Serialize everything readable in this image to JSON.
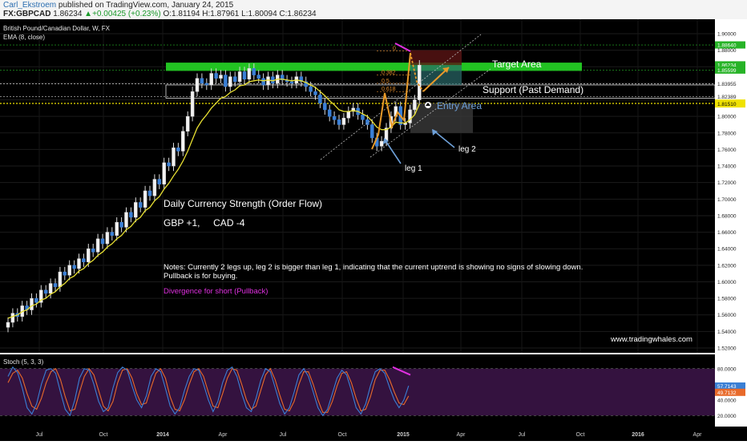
{
  "header": {
    "author": "Carl_Ekstroem",
    "published": "published on TradingView.com, January 24, 2015",
    "symbol": "FX:GBPCAD",
    "last": "1.86234",
    "change": "+0.00425 (+0.23%)",
    "ohlc": "O:1.81194 H:1.87961 L:1.80094 C:1.86234"
  },
  "chart_data": {
    "type": "line",
    "title": "British Pound/Canadian Dollar, W, FX",
    "indicator": "EMA (8, close)",
    "ylim": [
      1.51,
      1.91
    ],
    "y_ticks": [
      "1.90000",
      "1.88000",
      "1.86000",
      "1.84000",
      "1.82000",
      "1.80000",
      "1.78000",
      "1.76000",
      "1.74000",
      "1.72000",
      "1.70000",
      "1.68000",
      "1.66000",
      "1.64000",
      "1.62000",
      "1.60000",
      "1.58000",
      "1.56000",
      "1.54000",
      "1.52000"
    ],
    "x_ticks": [
      "Jul",
      "Oct",
      "2014",
      "Apr",
      "Jul",
      "Oct",
      "2015",
      "Apr",
      "Jul",
      "Oct",
      "2016",
      "Apr"
    ],
    "price_labels": [
      {
        "text": "1.88640",
        "color": "#27b327",
        "value": 1.8864
      },
      {
        "text": "1.86234",
        "color": "#27b327",
        "value": 1.8623
      },
      {
        "text": "1.85599",
        "color": "#27b327",
        "value": 1.856
      },
      {
        "text": "1.83955",
        "color": "#ffffff",
        "value": 1.8396
      },
      {
        "text": "1.82389",
        "color": "#ffffff",
        "value": 1.8239
      },
      {
        "text": "1.81614",
        "color": "#f0e200",
        "value": 1.8161
      },
      {
        "text": "1.81510",
        "color": "#f0e200",
        "value": 1.8151
      }
    ],
    "weekly_close": [
      1.551,
      1.562,
      1.558,
      1.571,
      1.566,
      1.58,
      1.575,
      1.59,
      1.586,
      1.598,
      1.594,
      1.612,
      1.608,
      1.62,
      1.616,
      1.628,
      1.624,
      1.64,
      1.636,
      1.652,
      1.646,
      1.66,
      1.656,
      1.672,
      1.666,
      1.684,
      1.678,
      1.696,
      1.69,
      1.71,
      1.704,
      1.724,
      1.718,
      1.744,
      1.74,
      1.762,
      1.758,
      1.782,
      1.8,
      1.83,
      1.846,
      1.84,
      1.838,
      1.852,
      1.846,
      1.85,
      1.836,
      1.848,
      1.842,
      1.854,
      1.845,
      1.858,
      1.85,
      1.846,
      1.838,
      1.848,
      1.84,
      1.85,
      1.844,
      1.842,
      1.84,
      1.848,
      1.842,
      1.836,
      1.83,
      1.826,
      1.816,
      1.808,
      1.8,
      1.796,
      1.79,
      1.798,
      1.806,
      1.81,
      1.802,
      1.796,
      1.79,
      1.774,
      1.764,
      1.77,
      1.786,
      1.8,
      1.812,
      1.79,
      1.792,
      1.808,
      1.82,
      1.862
    ],
    "ema_8": [
      1.556,
      1.558,
      1.56,
      1.564,
      1.566,
      1.571,
      1.573,
      1.578,
      1.58,
      1.585,
      1.588,
      1.594,
      1.598,
      1.604,
      1.607,
      1.613,
      1.616,
      1.622,
      1.626,
      1.632,
      1.636,
      1.642,
      1.646,
      1.652,
      1.656,
      1.663,
      1.667,
      1.674,
      1.678,
      1.686,
      1.69,
      1.698,
      1.703,
      1.712,
      1.719,
      1.728,
      1.736,
      1.746,
      1.758,
      1.772,
      1.786,
      1.795,
      1.802,
      1.81,
      1.816,
      1.822,
      1.824,
      1.829,
      1.832,
      1.837,
      1.838,
      1.842,
      1.843,
      1.844,
      1.843,
      1.844,
      1.843,
      1.845,
      1.845,
      1.844,
      1.843,
      1.844,
      1.843,
      1.841,
      1.838,
      1.835,
      1.83,
      1.825,
      1.819,
      1.814,
      1.808,
      1.806,
      1.806,
      1.807,
      1.806,
      1.803,
      1.8,
      1.794,
      1.787,
      1.784,
      1.784,
      1.787,
      1.793,
      1.792,
      1.792,
      1.796,
      1.802,
      1.815
    ],
    "zones": [
      {
        "label": "Target Area",
        "from": 1.855,
        "to": 1.865,
        "color": "#22c322"
      },
      {
        "label": "Support (Past Demand)",
        "from": 1.822,
        "to": 1.838
      },
      {
        "label": "Entry Area",
        "from": 1.815,
        "to": 1.816
      }
    ],
    "fib_levels": [
      "0",
      "0.382",
      "0.5",
      "0.618"
    ],
    "annotations": [
      {
        "text": "Target Area"
      },
      {
        "text": "Support (Past Demand)"
      },
      {
        "text": "Entry Area"
      },
      {
        "text": "leg 1"
      },
      {
        "text": "leg 2"
      },
      {
        "text": "Daily Currency Strength (Order Flow)"
      },
      {
        "text": "GBP +1,     CAD -4"
      },
      {
        "text": "Notes: Currently 2 legs up, leg 2 is bigger than leg 1, indicating that the current uptrend is showing no signs of slowing down."
      },
      {
        "text": "Pullback is for buying."
      },
      {
        "text": "Divergence for short (Pullback)",
        "color": "#e030e0"
      },
      {
        "text": "www.tradingwhales.com"
      }
    ],
    "stoch": {
      "title": "Stoch (5, 3, 3)",
      "ylim": [
        10,
        90
      ],
      "y_ticks": [
        "80.0000",
        "40.0000",
        "20.0000"
      ],
      "k_label": "57.7143",
      "d_label": "49.7132",
      "k": [
        70,
        82,
        75,
        55,
        30,
        22,
        35,
        60,
        78,
        80,
        74,
        50,
        28,
        20,
        40,
        68,
        80,
        78,
        60,
        38,
        25,
        30,
        55,
        75,
        82,
        78,
        58,
        40,
        30,
        45,
        70,
        80,
        76,
        55,
        32,
        22,
        30,
        52,
        70,
        80,
        78,
        60,
        40,
        25,
        38,
        62,
        78,
        82,
        70,
        48,
        30,
        25,
        42,
        65,
        80,
        76,
        56,
        35,
        22,
        30,
        50,
        72,
        80,
        70,
        50,
        30,
        20,
        28,
        48,
        68,
        78,
        72,
        52,
        30,
        22,
        35,
        58,
        76,
        80,
        74,
        56,
        40,
        30,
        40,
        58
      ],
      "d": [
        62,
        74,
        78,
        68,
        48,
        32,
        28,
        42,
        62,
        76,
        80,
        66,
        44,
        26,
        28,
        50,
        70,
        80,
        72,
        52,
        32,
        26,
        38,
        62,
        78,
        80,
        68,
        48,
        34,
        36,
        56,
        74,
        80,
        68,
        44,
        28,
        26,
        40,
        60,
        76,
        80,
        70,
        50,
        32,
        30,
        48,
        68,
        80,
        78,
        60,
        40,
        28,
        32,
        52,
        72,
        80,
        66,
        46,
        28,
        26,
        38,
        60,
        76,
        76,
        60,
        40,
        24,
        24,
        38,
        58,
        74,
        76,
        62,
        42,
        26,
        28,
        44,
        66,
        78,
        78,
        66,
        50,
        36,
        34,
        45
      ],
      "divergence_label": ""
    }
  }
}
